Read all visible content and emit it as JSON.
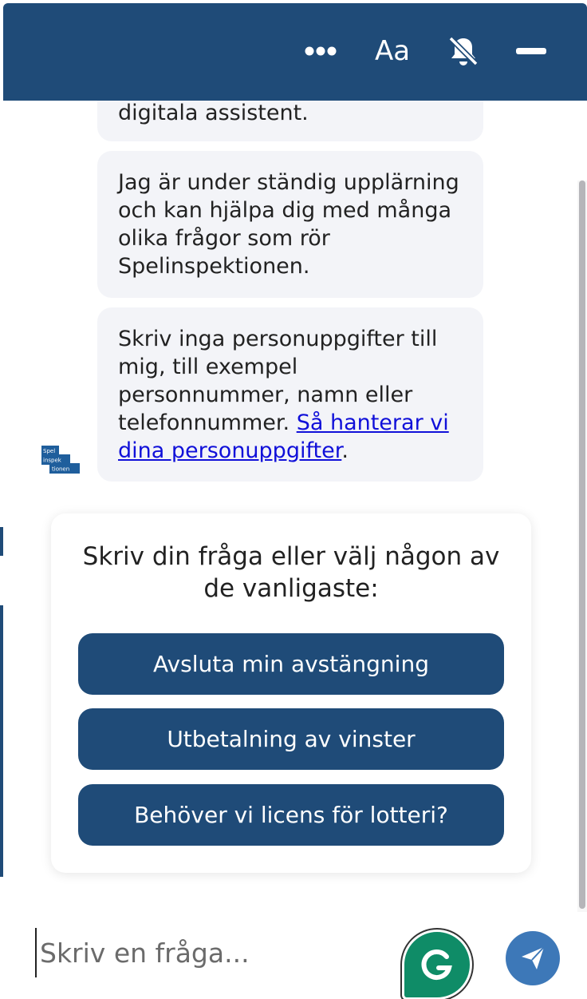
{
  "header": {
    "more_label": "•••",
    "font_label": "Aa"
  },
  "messages": [
    {
      "text": "digitala assistent."
    },
    {
      "text": "Jag är under ständig upplärning och kan hjälpa dig med många olika frågor som rör Spelinspektionen."
    },
    {
      "text": "Skriv inga personuppgifter till mig, till exempel personnummer, namn eller telefonnummer. ",
      "link_text": "Så hanterar vi dina personuppgifter",
      "suffix": "."
    }
  ],
  "avatar": {
    "line1": "Spel",
    "line2": "inspek",
    "line3": "tionen"
  },
  "quick_replies": {
    "title": "Skriv din fråga eller välj någon av de vanligaste:",
    "options": [
      {
        "label": "Avsluta min avstängning"
      },
      {
        "label": "Utbetalning av vinster"
      },
      {
        "label": "Behöver vi licens för lotteri?"
      }
    ]
  },
  "composer": {
    "placeholder": "Skriv en fråga..."
  },
  "colors": {
    "brand": "#1f4b78",
    "send": "#3d78b8",
    "grammarly": "#0f8c67",
    "bubble": "#f3f4f8",
    "link": "#1010d9"
  }
}
